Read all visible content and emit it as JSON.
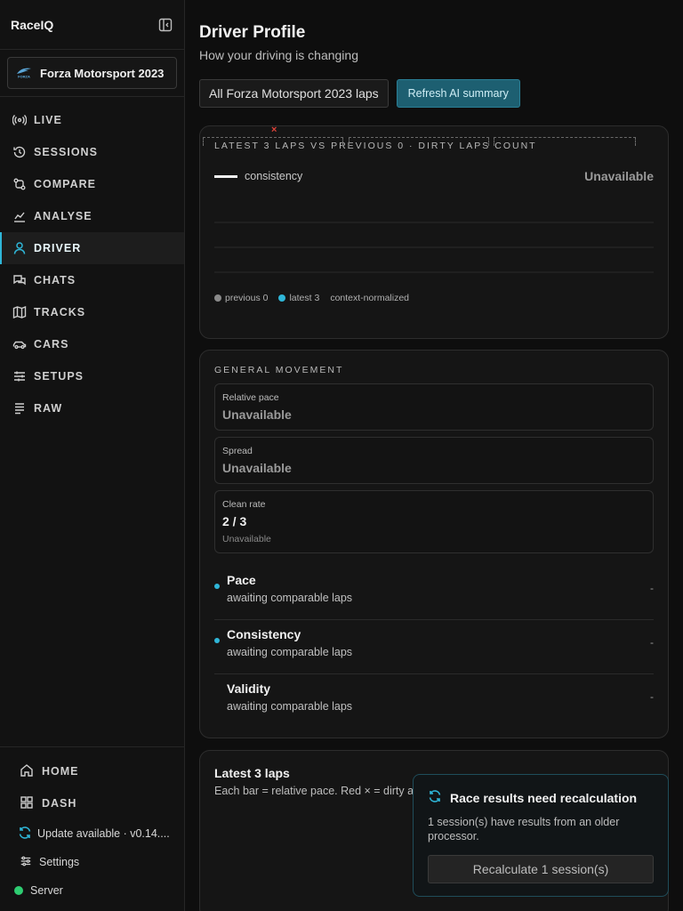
{
  "app": {
    "brand": "RaceIQ",
    "game": "Forza Motorsport 2023"
  },
  "sidebar": {
    "items": [
      {
        "label": "LIVE",
        "icon": "radio-icon"
      },
      {
        "label": "SESSIONS",
        "icon": "history-icon"
      },
      {
        "label": "COMPARE",
        "icon": "compare-icon"
      },
      {
        "label": "ANALYSE",
        "icon": "chart-icon"
      },
      {
        "label": "DRIVER",
        "icon": "user-icon",
        "active": true
      },
      {
        "label": "CHATS",
        "icon": "chat-icon"
      },
      {
        "label": "TRACKS",
        "icon": "map-icon"
      },
      {
        "label": "CARS",
        "icon": "car-icon"
      },
      {
        "label": "SETUPS",
        "icon": "sliders-icon"
      },
      {
        "label": "RAW",
        "icon": "list-icon"
      }
    ],
    "bottom": {
      "home": "HOME",
      "dash": "DASH",
      "update": "Update available · v0.14....",
      "settings": "Settings",
      "server": "Server"
    }
  },
  "page": {
    "title": "Driver Profile",
    "subtitle": "How your driving is changing",
    "scope_button": "All Forza Motorsport 2023 laps",
    "refresh_button": "Refresh AI summary"
  },
  "consistency_card": {
    "label": "LATEST 3 LAPS VS PREVIOUS 0 · DIRTY LAPS COUNT",
    "metric_label": "consistency",
    "metric_value": "Unavailable",
    "legend": {
      "previous": "previous 0",
      "latest": "latest 3",
      "note": "context-normalized"
    }
  },
  "movement_card": {
    "label": "GENERAL MOVEMENT",
    "stats": [
      {
        "label": "Relative pace",
        "value": "Unavailable"
      },
      {
        "label": "Spread",
        "value": "Unavailable"
      },
      {
        "label": "Clean rate",
        "value": "2 / 3",
        "note": "Unavailable"
      }
    ],
    "trends": [
      {
        "title": "Pace",
        "sub": "awaiting comparable laps",
        "value": "-"
      },
      {
        "title": "Consistency",
        "sub": "awaiting comparable laps",
        "value": "-"
      },
      {
        "title": "Validity",
        "sub": "awaiting comparable laps",
        "value": "-"
      }
    ]
  },
  "laps_card": {
    "title": "Latest 3 laps",
    "subtitle": "Each bar = relative pace. Red × = dirty an",
    "dirty_marker": "×"
  },
  "toast": {
    "title": "Race results need recalculation",
    "message": "1 session(s) have results from an older processor.",
    "button": "Recalculate 1 session(s)"
  },
  "colors": {
    "accent": "#2fb6d8",
    "server_status": "#2ecc71",
    "dirty": "#e0433a",
    "previous_dot": "#8a8a8a"
  }
}
